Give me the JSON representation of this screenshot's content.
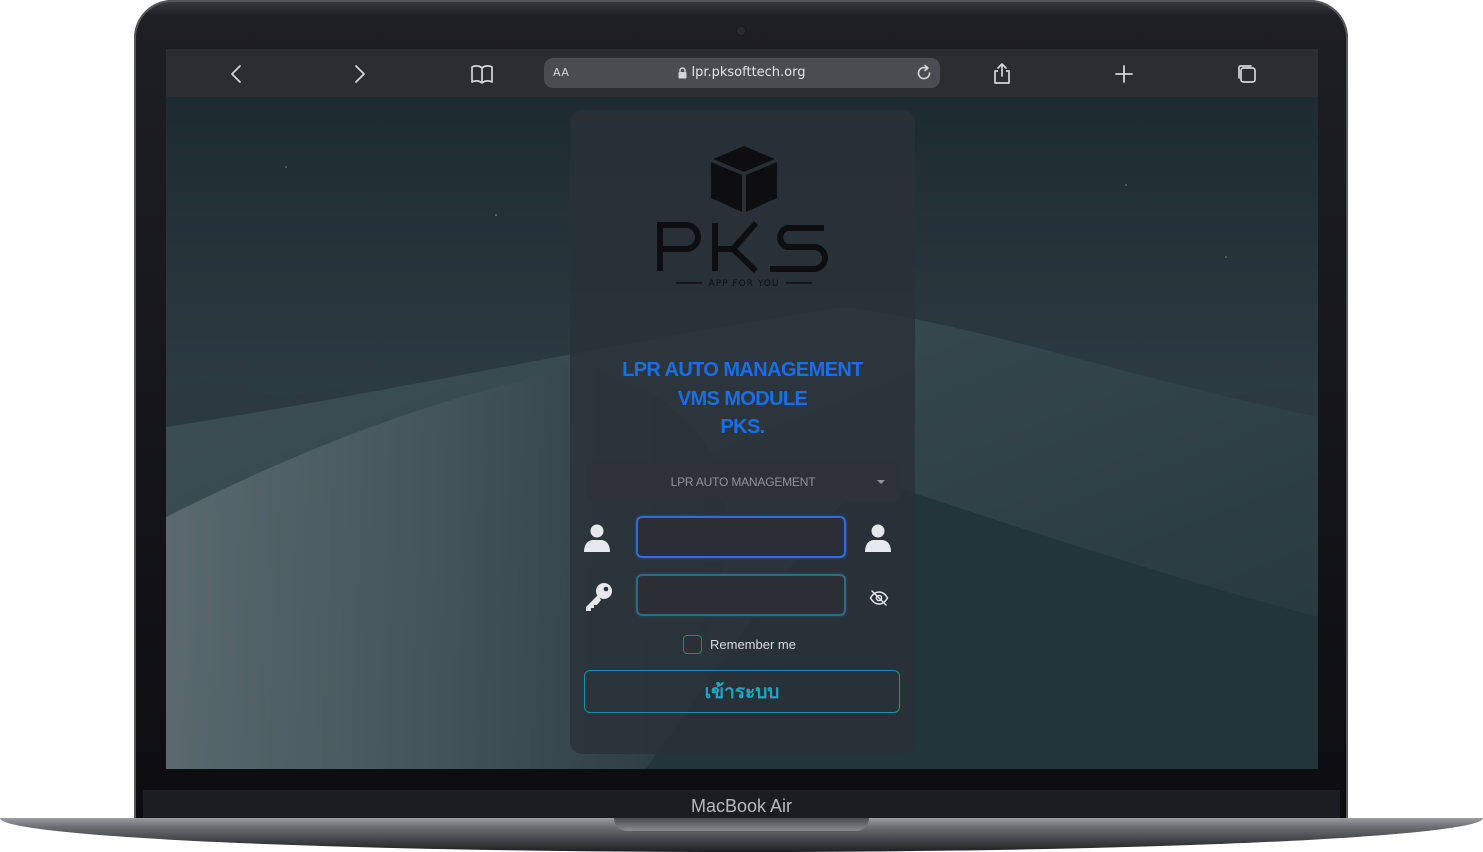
{
  "device": {
    "label": "MacBook Air"
  },
  "browser": {
    "text_size_label": "AA",
    "url": "lpr.pksofttech.org",
    "icons": [
      "back-icon",
      "forward-icon",
      "bookmarks-icon",
      "lock-icon",
      "reload-icon",
      "share-icon",
      "new-tab-icon",
      "tabs-icon"
    ]
  },
  "login": {
    "logo_brand": "PKS",
    "logo_tagline": "APP FOR YOU",
    "heading_lines": [
      "LPR AUTO MANAGEMENT",
      "VMS MODULE",
      "PKS."
    ],
    "module_select": {
      "selected": "LPR AUTO MANAGEMENT"
    },
    "username": {
      "value": ""
    },
    "password": {
      "value": ""
    },
    "remember_label": "Remember me",
    "submit_label": "เข้าระบบ"
  },
  "colors": {
    "accent_heading": "#1a6fe8",
    "button_text": "#1da6c2",
    "checkbox_border": "#2f8a57"
  }
}
